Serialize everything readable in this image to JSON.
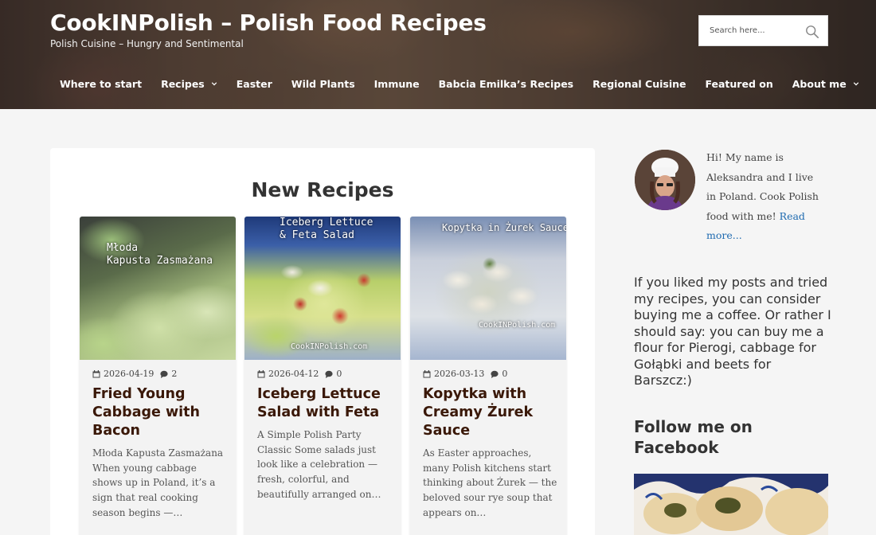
{
  "header": {
    "site_title": "CookINPolish – Polish Food Recipes",
    "tagline": "Polish Cuisine – Hungry and Sentimental",
    "search_placeholder": "Search here..."
  },
  "nav": {
    "items": [
      {
        "label": "Where to start",
        "has_dropdown": false
      },
      {
        "label": "Recipes",
        "has_dropdown": true
      },
      {
        "label": "Easter",
        "has_dropdown": false
      },
      {
        "label": "Wild Plants",
        "has_dropdown": false
      },
      {
        "label": "Immune",
        "has_dropdown": false
      },
      {
        "label": "Babcia Emilka’s Recipes",
        "has_dropdown": false
      },
      {
        "label": "Regional Cuisine",
        "has_dropdown": false
      },
      {
        "label": "Featured on",
        "has_dropdown": false
      },
      {
        "label": "About me",
        "has_dropdown": true
      }
    ]
  },
  "main": {
    "heading": "New Recipes",
    "recipes": [
      {
        "date": "2026-04-19",
        "comments": "2",
        "title": "Fried Young Cabbage with Bacon",
        "excerpt": "Młoda Kapusta Zasmażana When young cabbage shows up in Poland, it’s a sign that real cooking season begins —…",
        "image_caption": [
          "Młoda",
          "Kapusta Zasmażana"
        ],
        "image_watermark": ""
      },
      {
        "date": "2026-04-12",
        "comments": "0",
        "title": "Iceberg Lettuce Salad with Feta",
        "excerpt": "A Simple Polish Party Classic Some salads just look like a celebration — fresh, colorful, and beautifully arranged on…",
        "image_caption": [
          "Iceberg Lettuce",
          "& Feta Salad"
        ],
        "image_watermark": "CookINPolish.com"
      },
      {
        "date": "2026-03-13",
        "comments": "0",
        "title": "Kopytka with Creamy Żurek Sauce",
        "excerpt": "As Easter approaches, many Polish kitchens start thinking about Żurek — the beloved sour rye soup that appears on…",
        "image_caption": [
          "Kopytka in Żurek Sauce"
        ],
        "image_watermark": "CookINPolish.com"
      }
    ]
  },
  "sidebar": {
    "bio_text": "Hi! My name is Aleksandra and I live in Poland. Cook Polish food with me!",
    "read_more": "Read more...",
    "coffee_text": "If you liked my posts and tried my recipes, you can consider buying me a coffee. Or rather I should say: you can buy me a flour for Pierogi, cabbage for Gołąbki and beets for Barszcz:)",
    "follow_heading": "Follow me on Facebook"
  },
  "colors": {
    "recipe_title": "#3a1808",
    "link": "#1e6ab0",
    "page_bg": "#f5f5f5"
  },
  "icons": [
    "search-icon",
    "chevron-down-icon",
    "calendar-icon",
    "comment-icon"
  ]
}
